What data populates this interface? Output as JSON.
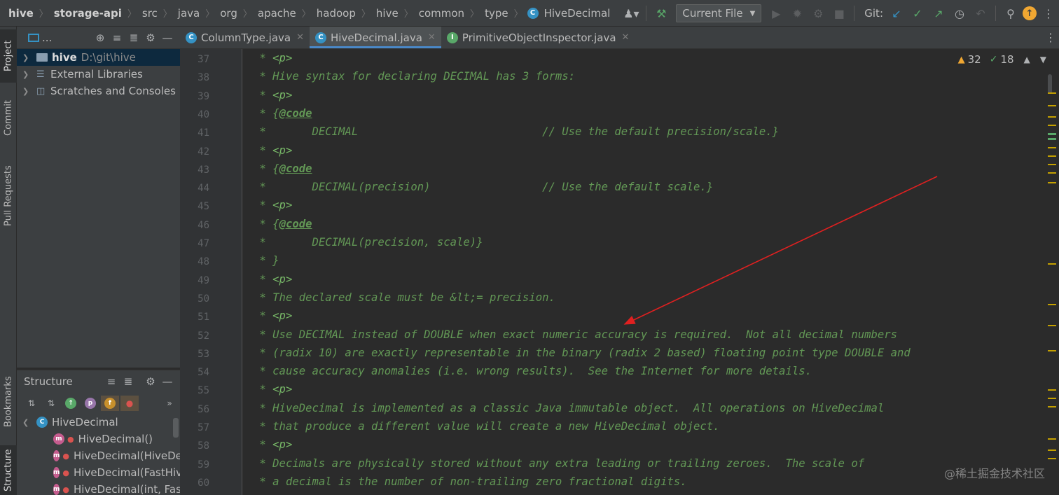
{
  "breadcrumb": {
    "items": [
      "hive",
      "storage-api",
      "src",
      "java",
      "org",
      "apache",
      "hadoop",
      "hive",
      "common",
      "type"
    ],
    "current_file": "HiveDecimal",
    "current_file_icon": "C"
  },
  "toolbar": {
    "run_config": "Current File",
    "git_label": "Git:"
  },
  "left_strip": {
    "project": "Project",
    "commit": "Commit",
    "pull_requests": "Pull Requests",
    "bookmarks": "Bookmarks",
    "structure": "Structure"
  },
  "project_panel": {
    "title": "...",
    "tree": [
      {
        "label": "hive",
        "path": "D:\\git\\hive"
      },
      {
        "label": "External Libraries"
      },
      {
        "label": "Scratches and Consoles"
      }
    ]
  },
  "structure_panel": {
    "title": "Structure",
    "root": "HiveDecimal",
    "members": [
      "HiveDecimal()",
      "HiveDecimal(HiveDe",
      "HiveDecimal(FastHiv",
      "HiveDecimal(int, Fas"
    ]
  },
  "tabs": [
    {
      "label": "ColumnType.java",
      "icon": "C"
    },
    {
      "label": "HiveDecimal.java",
      "icon": "C"
    },
    {
      "label": "PrimitiveObjectInspector.java",
      "icon": "I"
    }
  ],
  "inspections": {
    "warnings": "32",
    "weak_warnings": "18"
  },
  "editor": {
    "line_numbers": [
      "37",
      "38",
      "39",
      "40",
      "41",
      "42",
      "43",
      "44",
      "45",
      "46",
      "47",
      "48",
      "49",
      "50",
      "51",
      "52",
      "53",
      "54",
      "55",
      "56",
      "57",
      "58",
      "59",
      "60"
    ],
    "lines": [
      " * <p>",
      " * Hive syntax for declaring DECIMAL has 3 forms:",
      " * <p>",
      " * {@code",
      " *       DECIMAL                            // Use the default precision/scale.}",
      " * <p>",
      " * {@code",
      " *       DECIMAL(precision)                 // Use the default scale.}",
      " * <p>",
      " * {@code",
      " *       DECIMAL(precision, scale)}",
      " * }",
      " * <p>",
      " * The declared scale must be &lt;= precision.",
      " * <p>",
      " * Use DECIMAL instead of DOUBLE when exact numeric accuracy is required.  Not all decimal numbers",
      " * (radix 10) are exactly representable in the binary (radix 2 based) floating point type DOUBLE and",
      " * cause accuracy anomalies (i.e. wrong results).  See the Internet for more details.",
      " * <p>",
      " * HiveDecimal is implemented as a classic Java immutable object.  All operations on HiveDecimal",
      " * that produce a different value will create a new HiveDecimal object.",
      " * <p>",
      " * Decimals are physically stored without any extra leading or trailing zeroes.  The scale of",
      " * a decimal is the number of non-trailing zero fractional digits."
    ]
  },
  "watermark": "@稀土掘金技术社区",
  "colors": {
    "background": "#2b2b2b",
    "comment": "#629755",
    "accent": "#4a88c7",
    "annotation_arrow": "#e02020"
  }
}
